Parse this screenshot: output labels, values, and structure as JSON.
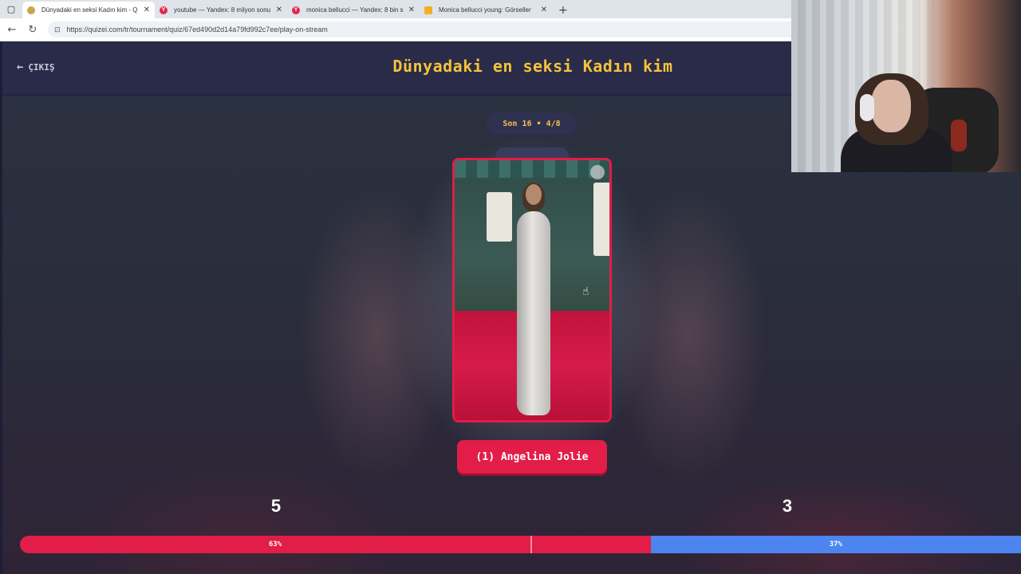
{
  "browser": {
    "tabs": [
      {
        "title": "Dünyadaki en seksi Kadın kim - Q",
        "favicon_color": "#c8a44a",
        "active": true
      },
      {
        "title": "youtube — Yandex: 8 milyon sonu",
        "favicon_color": "#e0294a",
        "favicon_letter": "Y",
        "active": false
      },
      {
        "title": "monica bellucci — Yandex: 8 bin s",
        "favicon_color": "#e0294a",
        "favicon_letter": "Y",
        "active": false
      },
      {
        "title": "Monica bellucci young: Görseller",
        "favicon_color": "#f0b020",
        "active": false
      }
    ],
    "url": "https://quizei.com/tr/tournament/quiz/67ed490d2d14a79fd992c7ee/play-on-stream"
  },
  "header": {
    "exit_label": "ÇIKIŞ",
    "title": "Dünyadaki en seksi Kadın kim"
  },
  "round": {
    "label": "Son 16 • 4/8"
  },
  "candidate": {
    "name": "(1) Angelina Jolie"
  },
  "votes": {
    "left_count": "5",
    "right_count": "3",
    "left_percent_label": "63%",
    "right_percent_label": "37%",
    "left_fraction": 0.63
  },
  "colors": {
    "accent_red": "#e11d48",
    "accent_blue": "#4c85f0",
    "title_yellow": "#f5c33b"
  }
}
